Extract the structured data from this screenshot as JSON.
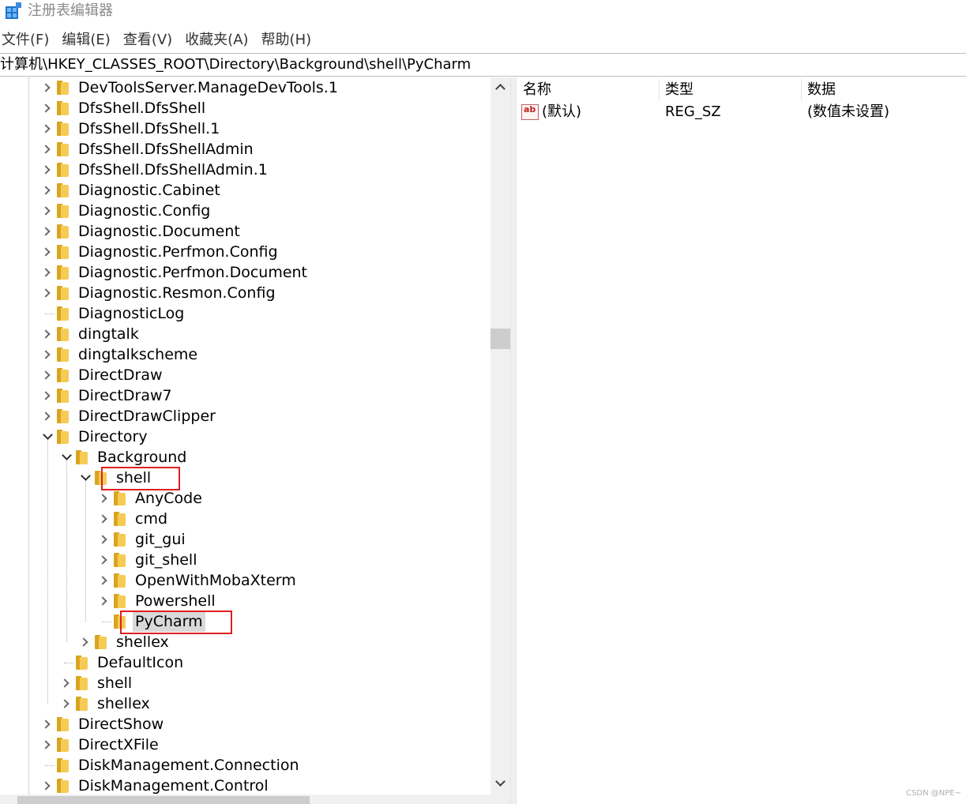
{
  "window": {
    "title": "注册表编辑器",
    "icon": "registry-editor-icon"
  },
  "menu": [
    "文件(F)",
    "编辑(E)",
    "查看(V)",
    "收藏夹(A)",
    "帮助(H)"
  ],
  "address": "计算机\\HKEY_CLASSES_ROOT\\Directory\\Background\\shell\\PyCharm",
  "tree": [
    {
      "label": "DevToolsServer.ManageDevTools.1",
      "level": 0,
      "expander": "collapsed"
    },
    {
      "label": "DfsShell.DfsShell",
      "level": 0,
      "expander": "collapsed"
    },
    {
      "label": "DfsShell.DfsShell.1",
      "level": 0,
      "expander": "collapsed"
    },
    {
      "label": "DfsShell.DfsShellAdmin",
      "level": 0,
      "expander": "collapsed"
    },
    {
      "label": "DfsShell.DfsShellAdmin.1",
      "level": 0,
      "expander": "collapsed"
    },
    {
      "label": "Diagnostic.Cabinet",
      "level": 0,
      "expander": "collapsed"
    },
    {
      "label": "Diagnostic.Config",
      "level": 0,
      "expander": "collapsed"
    },
    {
      "label": "Diagnostic.Document",
      "level": 0,
      "expander": "collapsed"
    },
    {
      "label": "Diagnostic.Perfmon.Config",
      "level": 0,
      "expander": "collapsed"
    },
    {
      "label": "Diagnostic.Perfmon.Document",
      "level": 0,
      "expander": "collapsed"
    },
    {
      "label": "Diagnostic.Resmon.Config",
      "level": 0,
      "expander": "collapsed"
    },
    {
      "label": "DiagnosticLog",
      "level": 0,
      "expander": "none"
    },
    {
      "label": "dingtalk",
      "level": 0,
      "expander": "collapsed"
    },
    {
      "label": "dingtalkscheme",
      "level": 0,
      "expander": "collapsed"
    },
    {
      "label": "DirectDraw",
      "level": 0,
      "expander": "collapsed"
    },
    {
      "label": "DirectDraw7",
      "level": 0,
      "expander": "collapsed"
    },
    {
      "label": "DirectDrawClipper",
      "level": 0,
      "expander": "collapsed"
    },
    {
      "label": "Directory",
      "level": 0,
      "expander": "expanded"
    },
    {
      "label": "Background",
      "level": 1,
      "expander": "expanded"
    },
    {
      "label": "shell",
      "level": 2,
      "expander": "expanded",
      "highlight": true
    },
    {
      "label": "AnyCode",
      "level": 3,
      "expander": "collapsed"
    },
    {
      "label": "cmd",
      "level": 3,
      "expander": "collapsed"
    },
    {
      "label": "git_gui",
      "level": 3,
      "expander": "collapsed"
    },
    {
      "label": "git_shell",
      "level": 3,
      "expander": "collapsed"
    },
    {
      "label": "OpenWithMobaXterm",
      "level": 3,
      "expander": "collapsed"
    },
    {
      "label": "Powershell",
      "level": 3,
      "expander": "collapsed"
    },
    {
      "label": "PyCharm",
      "level": 3,
      "expander": "none",
      "selected": true,
      "highlight": true
    },
    {
      "label": "shellex",
      "level": 2,
      "expander": "collapsed"
    },
    {
      "label": "DefaultIcon",
      "level": 1,
      "expander": "none"
    },
    {
      "label": "shell",
      "level": 1,
      "expander": "collapsed"
    },
    {
      "label": "shellex",
      "level": 1,
      "expander": "collapsed"
    },
    {
      "label": "DirectShow",
      "level": 0,
      "expander": "collapsed"
    },
    {
      "label": "DirectXFile",
      "level": 0,
      "expander": "collapsed"
    },
    {
      "label": "DiskManagement.Connection",
      "level": 0,
      "expander": "none"
    },
    {
      "label": "DiskManagement.Control",
      "level": 0,
      "expander": "collapsed"
    }
  ],
  "values": {
    "headers": {
      "name": "名称",
      "type": "类型",
      "data": "数据"
    },
    "rows": [
      {
        "name": "(默认)",
        "type": "REG_SZ",
        "data": "(数值未设置)",
        "icon_text": "ab"
      }
    ]
  },
  "watermark": "CSDN @NPE~"
}
